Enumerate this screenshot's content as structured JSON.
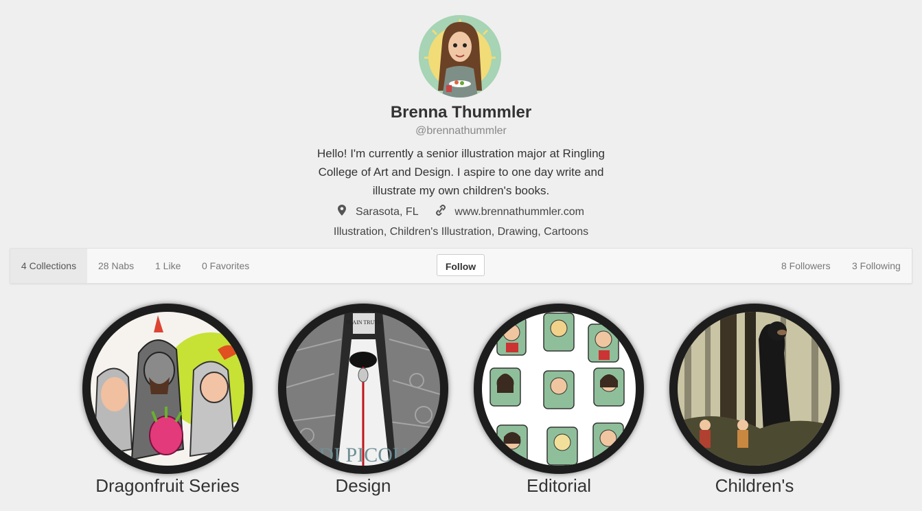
{
  "profile": {
    "name": "Brenna Thummler",
    "handle": "@brennathummler",
    "bio": "Hello! I'm currently a senior illustration major at Ringling College of Art and Design. I aspire to one day write and illustrate my own children's books.",
    "location": "Sarasota, FL",
    "website": "www.brennathummler.com",
    "tags": "Illustration, Children's Illustration, Drawing, Cartoons",
    "location_icon": "map-marker-icon",
    "link_icon": "link-icon"
  },
  "stats": {
    "collections": "4 Collections",
    "nabs": "28 Nabs",
    "likes": "1 Like",
    "favorites": "0 Favorites",
    "follow_label": "Follow",
    "followers": "8 Followers",
    "following": "3 Following"
  },
  "collections": [
    {
      "title": "Dragonfruit Series"
    },
    {
      "title": "Design",
      "poster_top": "PLAIN TRUTH",
      "poster_bottom": "DI PICOU"
    },
    {
      "title": "Editorial"
    },
    {
      "title": "Children's"
    }
  ]
}
